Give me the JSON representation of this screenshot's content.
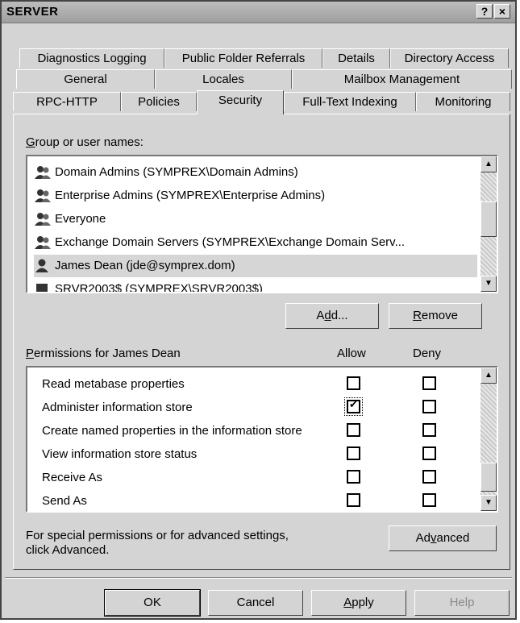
{
  "window": {
    "title": "SERVER",
    "help_btn": "?",
    "close_btn": "×"
  },
  "tabs": {
    "row1": [
      "Diagnostics Logging",
      "Public Folder Referrals",
      "Details",
      "Directory Access"
    ],
    "row2": [
      "General",
      "Locales",
      "Mailbox Management"
    ],
    "row3": [
      "RPC-HTTP",
      "Policies",
      "Security",
      "Full-Text Indexing",
      "Monitoring"
    ],
    "active": "Security"
  },
  "groups": {
    "label_prefix": "G",
    "label_rest": "roup or user names:",
    "items": [
      {
        "text": "Domain Admins (SYMPREX\\Domain Admins)",
        "icon": "group-icon",
        "selected": false
      },
      {
        "text": "Enterprise Admins (SYMPREX\\Enterprise Admins)",
        "icon": "group-icon",
        "selected": false
      },
      {
        "text": "Everyone",
        "icon": "group-icon",
        "selected": false
      },
      {
        "text": "Exchange Domain Servers (SYMPREX\\Exchange Domain Serv...",
        "icon": "group-icon",
        "selected": false
      },
      {
        "text": "James Dean (jde@symprex.dom)",
        "icon": "user-icon",
        "selected": true
      },
      {
        "text": "SRVR2003$ (SYMPREX\\SRVR2003$)",
        "icon": "computer-icon",
        "selected": false
      }
    ]
  },
  "buttons": {
    "add_prefix": "A",
    "add_u": "d",
    "add_rest": "d...",
    "remove_u": "R",
    "remove_rest": "emove",
    "advanced_prefix": "Ad",
    "advanced_u": "v",
    "advanced_rest": "anced",
    "ok": "OK",
    "cancel": "Cancel",
    "apply_u": "A",
    "apply_rest": "pply",
    "help": "Help"
  },
  "permissions": {
    "label_u": "P",
    "label_rest": "ermissions for James Dean",
    "allow_header": "Allow",
    "deny_header": "Deny",
    "items": [
      {
        "name": "Read metabase properties",
        "allow": false,
        "deny": false
      },
      {
        "name": "Administer information store",
        "allow": true,
        "deny": false
      },
      {
        "name": "Create named properties in the information store",
        "allow": false,
        "deny": false
      },
      {
        "name": "View information store status",
        "allow": false,
        "deny": false
      },
      {
        "name": "Receive As",
        "allow": false,
        "deny": false
      },
      {
        "name": "Send As",
        "allow": false,
        "deny": false
      }
    ]
  },
  "advanced_text": {
    "line1": "For special permissions or for advanced settings,",
    "line2": "click Advanced."
  }
}
